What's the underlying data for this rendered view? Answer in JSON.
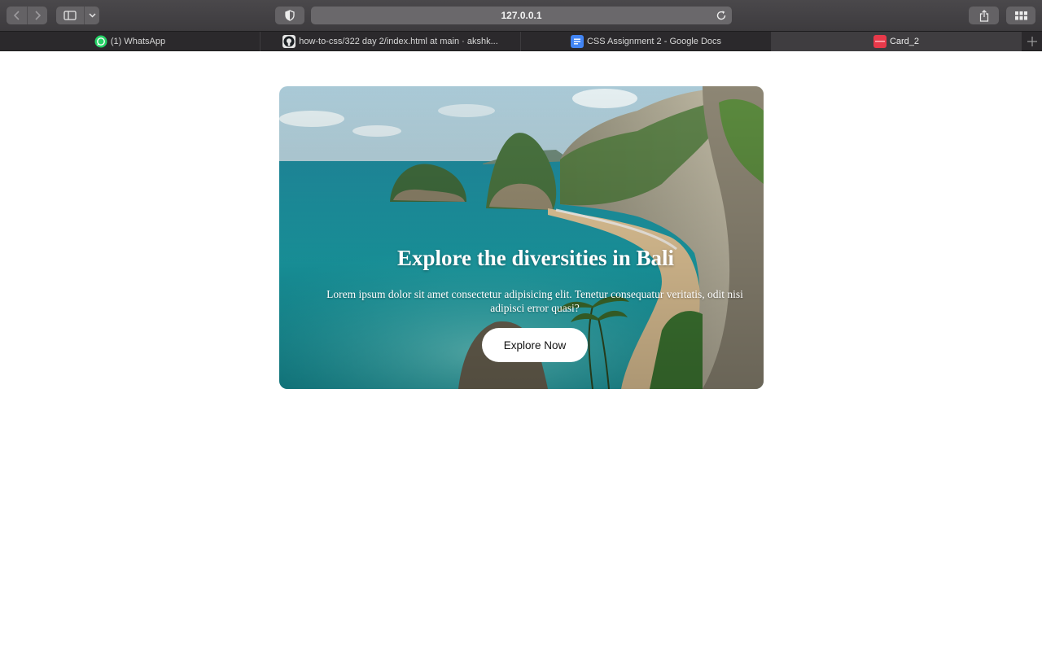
{
  "browser": {
    "url": "127.0.0.1",
    "tabs": [
      {
        "title": "(1) WhatsApp",
        "icon": "whatsapp-icon",
        "active": false
      },
      {
        "title": "how-to-css/322 day 2/index.html at main · akshk...",
        "icon": "github-icon",
        "active": false
      },
      {
        "title": "CSS Assignment 2 - Google Docs",
        "icon": "google-docs-icon",
        "active": false
      },
      {
        "title": "Card_2",
        "icon": "site-favicon",
        "active": true
      }
    ]
  },
  "card": {
    "title": "Explore the diversities in Bali",
    "text": "Lorem ipsum dolor sit amet consectetur adipisicing elit. Tenetur consequatur veritatis, odit nisi adipisci error quasi?",
    "button": "Explore Now"
  },
  "colors": {
    "chrome_toolbar": "#444245",
    "chrome_tabbar": "#2b292c",
    "whatsapp": "#25d366",
    "docs": "#4285f4",
    "favicon": "#e8394a"
  }
}
